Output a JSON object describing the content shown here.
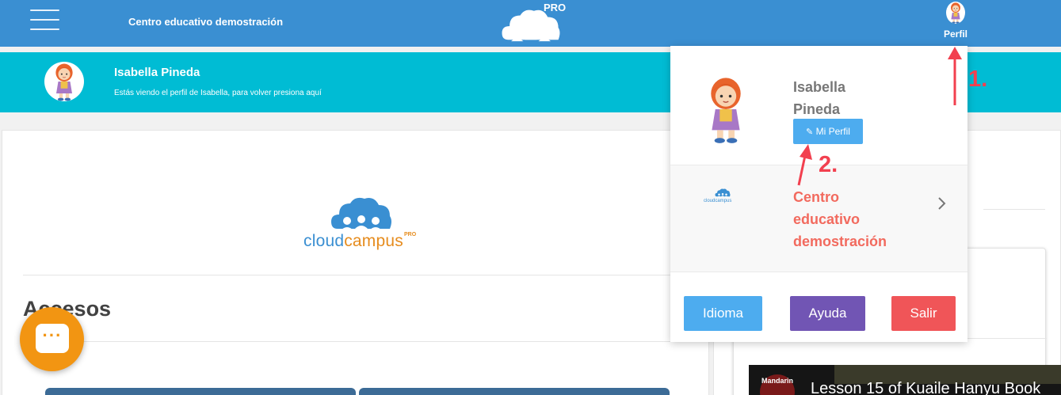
{
  "header": {
    "school_name": "Centro educativo demostración",
    "logo_tag": "PRO",
    "profile_label": "Perfil"
  },
  "viewing_bar": {
    "user_name": "Isabella Pineda",
    "note": "Estás viendo el perfil de Isabella, para volver presiona aquí"
  },
  "main": {
    "logo": {
      "brand_light": "cloud",
      "brand_bold": "campus",
      "brand_tag": "PRO"
    },
    "section_title": "Accesos"
  },
  "dropdown": {
    "user_name": "Isabella Pineda",
    "my_profile_label": "Mi Perfil",
    "school_name": "Centro educativo demostración",
    "school_logo_text": "cloudcampus",
    "buttons": {
      "language": "Idioma",
      "help": "Ayuda",
      "logout": "Salir"
    }
  },
  "annotations": {
    "step1": "1.",
    "step2": "2."
  },
  "video": {
    "channel": "Mandarin",
    "title": "Lesson 15 of Kuaile Hanyu Book"
  },
  "colors": {
    "topbar": "#3a8fd2",
    "viewing_bar": "#00bcd4",
    "language_button": "#4dacef",
    "help_button": "#7155b4",
    "logout_button": "#f05558",
    "annotation": "#f2404f",
    "chat_button": "#f29512"
  },
  "icons": {
    "menu": "hamburger-icon",
    "edit": "pencil-icon",
    "next": "chevron-right-icon",
    "chat": "chat-bubble-icon"
  }
}
